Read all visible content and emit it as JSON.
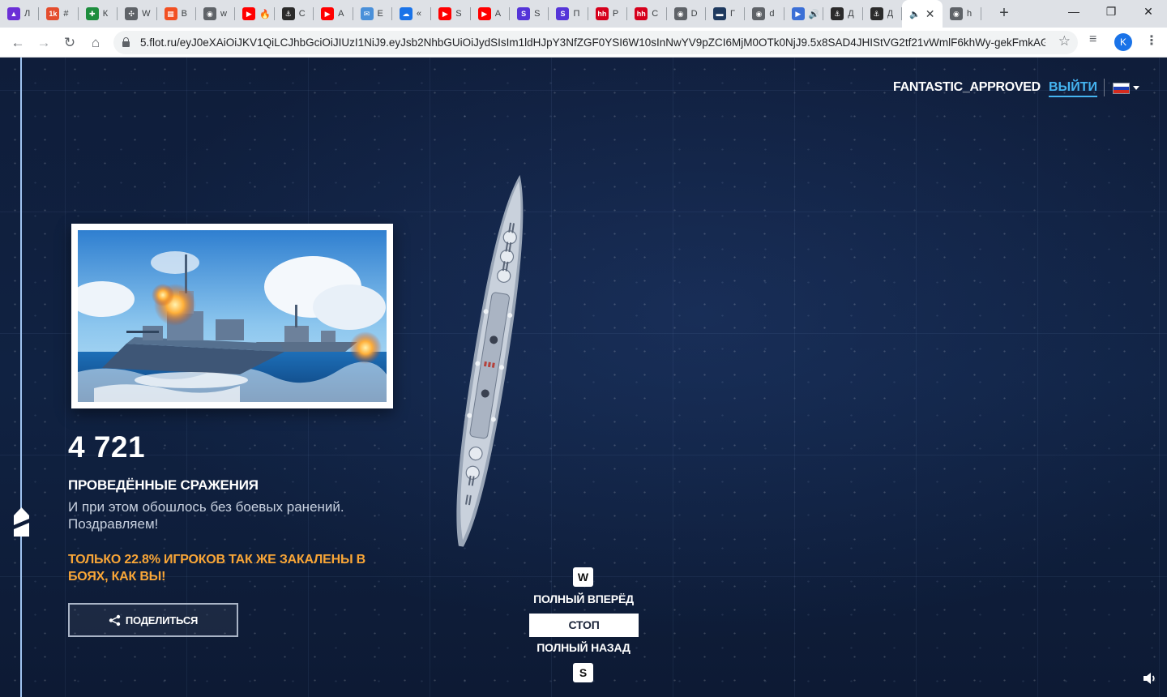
{
  "browser": {
    "tabs": [
      {
        "favicon": "purple-arrow-icon",
        "color": "#6b2fd6",
        "glyph": "▲",
        "title": "Л"
      },
      {
        "favicon": "ok-icon",
        "color": "#e44d2e",
        "glyph": "1k",
        "title": "#"
      },
      {
        "favicon": "green-cross-icon",
        "color": "#1e8e3e",
        "glyph": "✚",
        "title": "К"
      },
      {
        "favicon": "network-icon",
        "color": "#5f6368",
        "glyph": "✣",
        "title": "W"
      },
      {
        "favicon": "windows-icon",
        "color": "#f25022",
        "glyph": "▦",
        "title": "В"
      },
      {
        "favicon": "globe-icon",
        "color": "#5f6368",
        "glyph": "◉",
        "title": "w"
      },
      {
        "favicon": "youtube-fire-icon",
        "color": "#ff0000",
        "glyph": "▶",
        "title": "🔥"
      },
      {
        "favicon": "wows-icon",
        "color": "#2b2b2b",
        "glyph": "⚓",
        "title": "C"
      },
      {
        "favicon": "youtube-icon",
        "color": "#ff0000",
        "glyph": "▶",
        "title": "A"
      },
      {
        "favicon": "email-icon",
        "color": "#4a90d9",
        "glyph": "✉",
        "title": "E"
      },
      {
        "favicon": "cloud-icon",
        "color": "#1a73e8",
        "glyph": "☁",
        "title": "«"
      },
      {
        "favicon": "youtube-icon",
        "color": "#ff0000",
        "glyph": "▶",
        "title": "S"
      },
      {
        "favicon": "youtube-icon",
        "color": "#ff0000",
        "glyph": "▶",
        "title": "A"
      },
      {
        "favicon": "s-circle-icon",
        "color": "#5535d8",
        "glyph": "S",
        "title": "S"
      },
      {
        "favicon": "s-square-icon",
        "color": "#5535d8",
        "glyph": "S",
        "title": "П"
      },
      {
        "favicon": "hh-icon",
        "color": "#d6001c",
        "glyph": "hh",
        "title": "Р"
      },
      {
        "favicon": "hh-icon",
        "color": "#d6001c",
        "glyph": "hh",
        "title": "С"
      },
      {
        "favicon": "globe-icon",
        "color": "#5f6368",
        "glyph": "◉",
        "title": "D"
      },
      {
        "favicon": "square-icon",
        "color": "#1f3a5f",
        "glyph": "▬",
        "title": "Г"
      },
      {
        "favicon": "globe-icon",
        "color": "#5f6368",
        "glyph": "◉",
        "title": "d"
      },
      {
        "favicon": "play-icon",
        "color": "#3b6fd6",
        "glyph": "▶",
        "title": "🔊"
      },
      {
        "favicon": "wows-icon",
        "color": "#2b2b2b",
        "glyph": "⚓",
        "title": "Д"
      },
      {
        "favicon": "wows-icon",
        "color": "#2b2b2b",
        "glyph": "⚓",
        "title": "Д"
      }
    ],
    "active_tab": {
      "audio": "🔈",
      "close": "✕"
    },
    "last_tab": {
      "favicon": "globe-icon",
      "title": "h"
    },
    "new_tab": "+",
    "window_controls": {
      "minimize": "—",
      "maximize": "❐",
      "close": "✕"
    },
    "nav": {
      "back": "←",
      "forward": "→",
      "reload": "↻",
      "home": "⌂"
    },
    "url": "5.flot.ru/eyJ0eXAiOiJKV1QiLCJhbGciOiJIUzI1NiJ9.eyJsb2NhbGUiOiJydSIsIm1ldHJpY3NfZGF0YSI6W10sInNwYV9pZCI6MjM0OTk0NjJ9.5x8SAD4JHIStVG2tf21vWmlF6khWy-gekFmkAG...",
    "star": "☆",
    "playlist_icon": "≡",
    "profile_letter": "K",
    "menu": "⋮"
  },
  "header": {
    "username": "FANTASTIC_APPROVED",
    "logout": "ВЫЙТИ",
    "language_flag_colors": [
      "#ffffff",
      "#1c3fb5",
      "#d52b1e"
    ]
  },
  "stats": {
    "number": "4 721",
    "title": "ПРОВЕДЁННЫЕ СРАЖЕНИЯ",
    "description": "И при этом обошлось без боевых ранений. Поздравляем!",
    "highlight": "ТОЛЬКО 22.8% ИГРОКОВ ТАК ЖЕ ЗАКАЛЕНЫ В БОЯХ, КАК ВЫ!",
    "share_label": "ПОДЕЛИТЬСЯ"
  },
  "controls": {
    "key_forward": "W",
    "forward_label": "ПОЛНЫЙ ВПЕРЁД",
    "stop_label": "СТОП",
    "back_label": "ПОЛНЫЙ НАЗАД",
    "key_back": "S"
  },
  "colors": {
    "accent_blue": "#45b4f0",
    "highlight_orange": "#f9a637",
    "ocean": "#102242"
  }
}
